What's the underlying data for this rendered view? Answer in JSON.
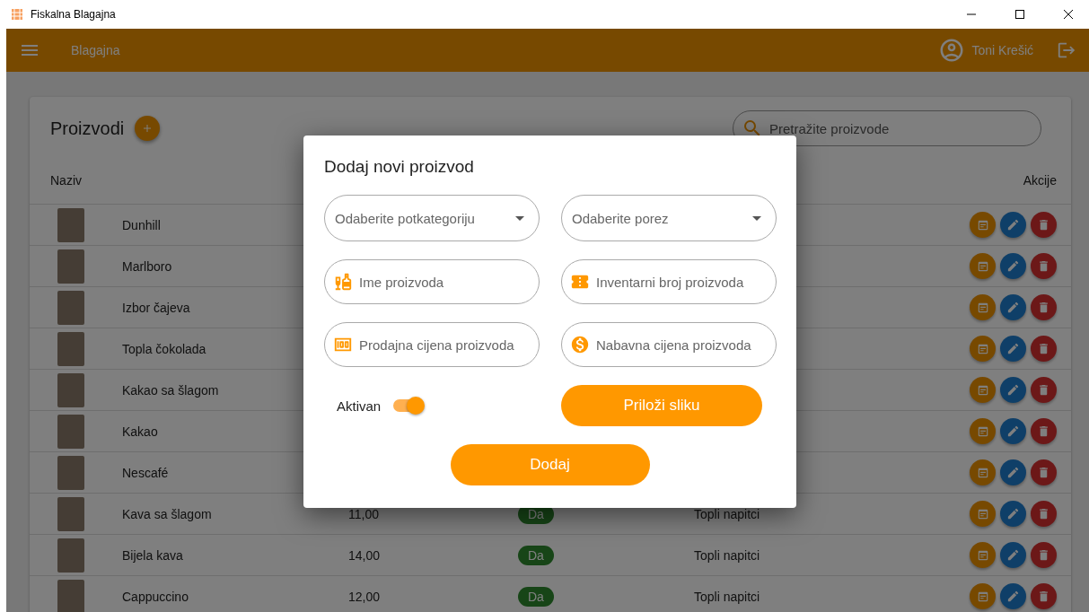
{
  "window": {
    "title": "Fiskalna Blagajna"
  },
  "app_bar": {
    "title": "Blagajna",
    "user_name": "Toni Krešić"
  },
  "products": {
    "title": "Proizvodi",
    "search": {
      "placeholder": "Pretražite proizvode"
    },
    "columns": [
      "Naziv",
      "Akcije"
    ],
    "rows": [
      {
        "name": "Dunhill"
      },
      {
        "name": "Marlboro"
      },
      {
        "name": "Izbor čajeva"
      },
      {
        "name": "Topla čokolada"
      },
      {
        "name": "Kakao sa šlagom"
      },
      {
        "name": "Kakao"
      },
      {
        "name": "Nescafé"
      },
      {
        "name": "Kava sa šlagom",
        "price": "11,00",
        "active": "Da",
        "category": "Topli napitci"
      },
      {
        "name": "Bijela kava",
        "price": "14,00",
        "active": "Da",
        "category": "Topli napitci"
      },
      {
        "name": "Cappuccino",
        "price": "12,00",
        "active": "Da",
        "category": "Topli napitci"
      }
    ]
  },
  "dialog": {
    "title": "Dodaj novi proizvod",
    "fields": [
      {
        "kind": "select",
        "placeholder": "Odaberite potkategoriju"
      },
      {
        "kind": "select",
        "placeholder": "Odaberite porez"
      },
      {
        "kind": "text",
        "placeholder": "Ime proizvoda"
      },
      {
        "kind": "text",
        "placeholder": "Inventarni broj proizvoda"
      },
      {
        "kind": "text",
        "placeholder": "Prodajna cijena proizvoda"
      },
      {
        "kind": "text",
        "placeholder": "Nabavna cijena proizvoda"
      }
    ],
    "active_toggle": {
      "label": "Aktivan",
      "on": true
    },
    "attach_button": "Priloži sliku",
    "submit_button": "Dodaj"
  }
}
